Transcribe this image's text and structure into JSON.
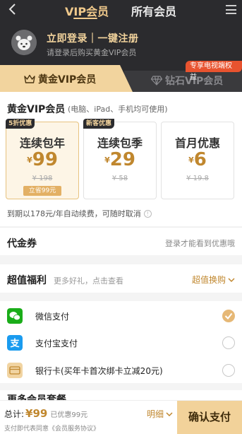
{
  "nav": {
    "tab_vip": "VIP会员",
    "tab_all": "所有会员"
  },
  "login": {
    "title": "立即登录｜一键注册",
    "subtitle": "请登录后购买黄金VIP会员"
  },
  "tiers": {
    "gold": "黄金VIP会员",
    "diamond": "钻石VIP会员",
    "diamond_badge": "专享电视端权益"
  },
  "plan_section": {
    "title": "黄金VIP会员",
    "subtitle": "(电脑、iPad、手机均可使用)",
    "plans": [
      {
        "tag": "5折优惠",
        "name": "连续包年",
        "currency": "¥",
        "price": "99",
        "original": "¥ 198",
        "save": "立省99元",
        "selected": true
      },
      {
        "tag": "新客优惠",
        "name": "连续包季",
        "currency": "¥",
        "price": "29",
        "original": "¥ 58",
        "save": "",
        "selected": false
      },
      {
        "tag": "",
        "name": "首月优惠",
        "currency": "¥",
        "price": "6",
        "original": "¥ 19.8",
        "save": "",
        "selected": false
      }
    ],
    "renew_note": "到期以178元/年自动续费，可随时取消"
  },
  "voucher": {
    "label": "代金券",
    "value": "登录才能看到优惠哦"
  },
  "benefits": {
    "label": "超值福利",
    "hint": "更多好礼，点击查看",
    "link": "超值换购"
  },
  "payment": {
    "options": [
      {
        "label": "微信支付",
        "checked": true
      },
      {
        "label": "支付宝支付",
        "checked": false
      },
      {
        "label": "银行卡(买年卡首次绑卡立减20元)",
        "checked": false
      }
    ]
  },
  "more": {
    "label": "更多会员套餐"
  },
  "bottom": {
    "total_label": "总计:",
    "total_price": "¥99",
    "discount": "已优惠99元",
    "agreement": "支付即代表同意《会员服务协议》",
    "details": "明细",
    "confirm": "确认支付"
  },
  "colors": {
    "header_bg": "#2b2b2e",
    "gold": "#f2d49e",
    "price": "#c0872e",
    "wechat": "#1aad19",
    "alipay": "#1a9bef"
  }
}
